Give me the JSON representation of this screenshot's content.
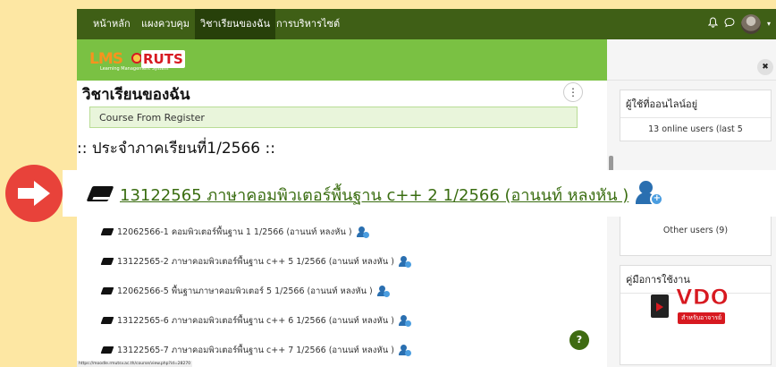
{
  "nav": {
    "items": [
      "หน้าหลัก",
      "แผงควบคุม",
      "วิชาเรียนของฉัน",
      "การบริหารไซต์"
    ],
    "active": "วิชาเรียนของฉัน"
  },
  "logo": {
    "lms": "LMS",
    "ruts": "RUTS",
    "subtitle": "Learning Management System"
  },
  "page": {
    "heading": "วิชาเรียนของฉัน",
    "course_from_register": "Course From Register",
    "term_heading": ":: ประจำภาคเรียนที่1/2566 ::"
  },
  "highlighted_course": "13122565 ภาษาคอมพิวเตอร์พื้นฐาน c++ 2 1/2566 (อานนท์ หลงหัน )",
  "courses": [
    "12062566-1 คอมพิวเตอร์พื้นฐาน 1 1/2566 (อานนท์ หลงหัน )",
    "13122565-2 ภาษาคอมพิวเตอร์พื้นฐาน c++ 5 1/2566 (อานนท์ หลงหัน )",
    "12062566-5 พื้นฐานภาษาคอมพิวเตอร์ 5 1/2566 (อานนท์ หลงหัน )",
    "13122565-6 ภาษาคอมพิวเตอร์พื้นฐาน c++ 6 1/2566 (อานนท์ หลงหัน )",
    "13122565-7 ภาษาคอมพิวเตอร์พื้นฐาน c++ 7 1/2566 (อานนท์ หลงหัน )"
  ],
  "drawer": {
    "online_title": "ผู้ใช้ที่ออนไลน์อยู่",
    "online_count": "13 online users (last 5",
    "other_users": "Other users (9)",
    "manual_title": "คู่มือการใช้งาน",
    "vdo_word": "VDO",
    "vdo_sub": "สำหรับอาจารย์"
  },
  "help_label": "?",
  "close_label": "✖",
  "kebab_label": "⋮",
  "status_url": "https://moodle.rmutsv.ac.th/course/view.php?id=28270",
  "icons": {
    "bell": "bell-icon",
    "chat": "chat-icon",
    "avatar": "avatar",
    "pointer": "arrow-right-icon",
    "course": "book-icon",
    "enrol": "enrol-user-icon"
  },
  "colors": {
    "nav_bg": "#3f5f16",
    "logo_bar": "#7ac143",
    "link": "#3a6d11",
    "accent_red": "#e8423a",
    "outer_bg": "#fde7a3"
  }
}
